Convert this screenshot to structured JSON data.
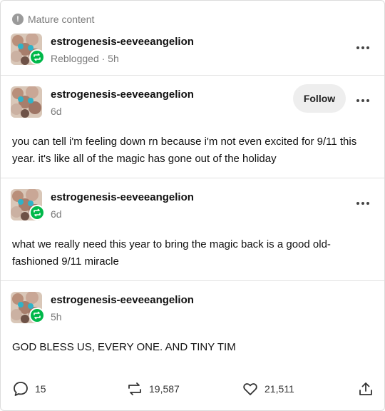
{
  "mature_label": "Mature content",
  "colors": {
    "accent_green": "#00b84a",
    "muted_text": "#7a7a7a",
    "follow_bg": "#eeeeee"
  },
  "header_reblog": {
    "blog": "estrogenesis-eeveeangelion",
    "subline": "Reblogged · 5h"
  },
  "posts": [
    {
      "blog": "estrogenesis-eeveeangelion",
      "time": "6d",
      "follow_label": "Follow",
      "text": "you can tell i'm feeling down rn because i'm not even excited for 9/11 this year. it's like all of the magic has gone out of the holiday"
    },
    {
      "blog": "estrogenesis-eeveeangelion",
      "time": "6d",
      "text": "what we really need this year to bring the magic back is a good old-fashioned 9/11 miracle"
    },
    {
      "blog": "estrogenesis-eeveeangelion",
      "time": "5h",
      "text": "GOD BLESS US, EVERY ONE. AND TINY TIM"
    }
  ],
  "footer": {
    "replies": "15",
    "reblogs": "19,587",
    "likes": "21,511"
  },
  "icons": [
    "warning-icon",
    "reblog-icon",
    "more-options-icon",
    "reply-icon",
    "reblog-count-icon",
    "heart-icon",
    "share-icon"
  ]
}
